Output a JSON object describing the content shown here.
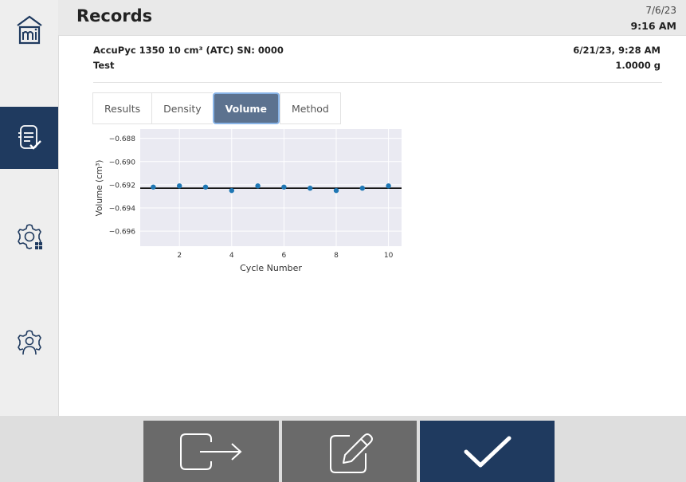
{
  "header": {
    "title": "Records",
    "date": "7/6/23",
    "time": "9:16 AM"
  },
  "sidebar": {
    "items": [
      {
        "icon": "home-logo-icon",
        "active": false
      },
      {
        "icon": "records-checklist-icon",
        "active": true
      },
      {
        "icon": "settings-apps-icon",
        "active": false
      },
      {
        "icon": "user-settings-icon",
        "active": false
      }
    ]
  },
  "record": {
    "instrument": "AccuPyc 1350 10 cm³ (ATC) SN: 0000",
    "sample": "Test",
    "datetime": "6/21/23, 9:28 AM",
    "mass": "1.0000 g"
  },
  "tabs": [
    {
      "label": "Results",
      "active": false
    },
    {
      "label": "Density",
      "active": false
    },
    {
      "label": "Volume",
      "active": true
    },
    {
      "label": "Method",
      "active": false
    }
  ],
  "chart_data": {
    "type": "scatter",
    "xlabel": "Cycle Number",
    "ylabel": "Volume (cm³)",
    "x": [
      1,
      2,
      3,
      4,
      5,
      6,
      7,
      8,
      9,
      10
    ],
    "y": [
      -0.6922,
      -0.6921,
      -0.6922,
      -0.6925,
      -0.6921,
      -0.6922,
      -0.6923,
      -0.6925,
      -0.6923,
      -0.6921
    ],
    "mean_line": -0.6923,
    "xlim": [
      0.5,
      10.5
    ],
    "ylim": [
      -0.6973,
      -0.6872
    ],
    "xticks": [
      2,
      4,
      6,
      8,
      10
    ],
    "yticks": [
      -0.688,
      -0.69,
      -0.692,
      -0.694,
      -0.696
    ],
    "ytick_labels": [
      "−0.688",
      "−0.690",
      "−0.692",
      "−0.694",
      "−0.696"
    ],
    "grid": true,
    "colors": {
      "point": "#1f77b4",
      "line": "#000000",
      "plot_bg": "#eaeaf2",
      "grid": "#ffffff"
    }
  },
  "bottom_bar": {
    "buttons": [
      {
        "icon": "exit-arrow-icon"
      },
      {
        "icon": "edit-pencil-icon"
      },
      {
        "icon": "checkmark-icon"
      }
    ]
  },
  "colors": {
    "accent": "#1f3a5f",
    "tab_active": "#5c728f",
    "button_gray": "#6a6a6a"
  }
}
